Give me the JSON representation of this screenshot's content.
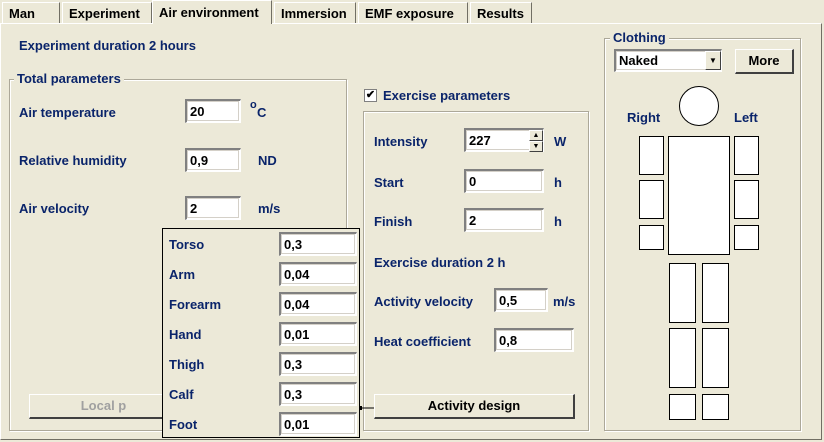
{
  "tabs": [
    {
      "label": "Man"
    },
    {
      "label": "Experiment"
    },
    {
      "label": "Air environment"
    },
    {
      "label": "Immersion"
    },
    {
      "label": "EMF exposure"
    },
    {
      "label": "Results"
    }
  ],
  "active_tab": "Air environment",
  "experiment_duration": "Experiment duration 2 hours",
  "total": {
    "title": "Total  parameters",
    "air_temperature": {
      "label": "Air temperature",
      "value": "20",
      "unit_sup": "o",
      "unit": "C"
    },
    "humidity": {
      "label": "Relative humidity",
      "value": "0,9",
      "unit": "ND"
    },
    "velocity": {
      "label": "Air velocity",
      "value": "2",
      "unit": "m/s"
    },
    "local_button": "Local p"
  },
  "local_popup": {
    "rows": [
      {
        "label": "Torso",
        "value": "0,3"
      },
      {
        "label": "Arm",
        "value": "0,04"
      },
      {
        "label": "Forearm",
        "value": "0,04"
      },
      {
        "label": "Hand",
        "value": "0,01"
      },
      {
        "label": "Thigh",
        "value": "0,3"
      },
      {
        "label": "Calf",
        "value": "0,3"
      },
      {
        "label": "Foot",
        "value": "0,01"
      }
    ]
  },
  "exercise": {
    "checkbox_label": "Exercise  parameters",
    "checked": true,
    "check_mark": "✔",
    "intensity": {
      "label": "Intensity",
      "value": "227",
      "unit": "W"
    },
    "start": {
      "label": "Start",
      "value": "0",
      "unit": "h"
    },
    "finish": {
      "label": "Finish",
      "value": "2",
      "unit": "h"
    },
    "duration": "Exercise duration 2 h",
    "activity_velocity": {
      "label": "Activity velocity",
      "value": "0,5",
      "unit": "m/s"
    },
    "heat_coefficient": {
      "label": "Heat coefficient",
      "value": "0,8"
    },
    "design_button": "Activity design"
  },
  "clothing": {
    "title": "Clothing",
    "selected": "Naked",
    "more_button": "More",
    "right_label": "Right",
    "left_label": "Left"
  }
}
